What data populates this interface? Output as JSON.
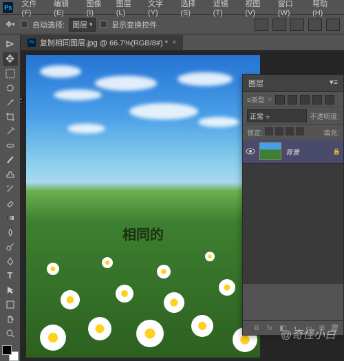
{
  "app": {
    "logo": "Ps"
  },
  "menu": {
    "file": "文件(F)",
    "edit": "编辑(E)",
    "image": "图像(I)",
    "layer": "图层(L)",
    "type": "文字(Y)",
    "select": "选择(S)",
    "filter": "滤镜(T)",
    "view": "视图(V)",
    "window": "窗口(W)",
    "help": "帮助(H)"
  },
  "options": {
    "auto_select_label": "自动选择:",
    "auto_select_target": "图层",
    "show_transform": "显示变换控件"
  },
  "document": {
    "tab_title": "复制相同图层.jpg @ 66.7%(RGB/8#) *",
    "center_text": "相同的"
  },
  "layers_panel": {
    "title": "图层",
    "kind_label": "≡类型",
    "blend_mode": "正常",
    "opacity_label": "不透明度:",
    "opacity_value": "",
    "lock_label": "锁定:",
    "fill_label": "填充:",
    "fill_value": "",
    "layer_name": "背景"
  },
  "watermark": "@奇怪小白"
}
